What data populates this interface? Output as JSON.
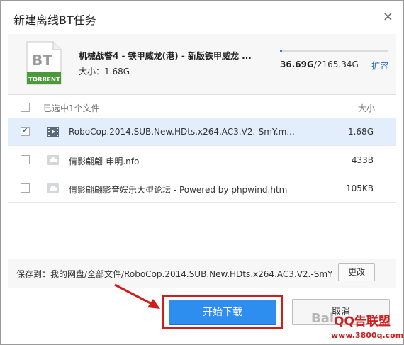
{
  "dialog": {
    "title": "新建离线BT任务",
    "close_glyph": "×"
  },
  "task": {
    "icon_text": "BT",
    "icon_label": "TORRENT",
    "name": "机械战警4 - 铁甲威龙(港) - 新版铁甲威龙 ...",
    "size_label": "大小：1.68G",
    "quota_used": "36.69G",
    "quota_total": "/2165.34G",
    "quota_fraction": 0.017,
    "expand_label": "扩容"
  },
  "list": {
    "header_label": "已选中1个文件",
    "header_size": "大小",
    "files": [
      {
        "name": "RoboCop.2014.SUB.New.HDts.x264.AC3.V2.-SmY.m...",
        "size": "1.68G",
        "checked": true,
        "icon": "video-file-icon"
      },
      {
        "name": "倩影翩翩-申明.nfo",
        "size": "433B",
        "checked": false,
        "icon": "cloud-file-icon"
      },
      {
        "name": "倩影翩翩影音娱乐大型论坛 - Powered by phpwind.htm",
        "size": "105KB",
        "checked": false,
        "icon": "cloud-file-icon"
      }
    ]
  },
  "save": {
    "label": "保存到：我的网盘/全部文件/RoboCop.2014.SUB.New.HDts.x264.AC3.V2.-SmY",
    "change_label": "更改"
  },
  "actions": {
    "start_label": "开始下载",
    "cancel_label": "取消"
  },
  "watermark": {
    "baidu": "Bai",
    "brand": "QQ告联盟",
    "url": "www.3800q.com"
  },
  "colors": {
    "accent": "#2e8ef0",
    "highlight_outline": "#d11c1c",
    "torrent_green": "#4a9a3a",
    "link": "#2a6fc9"
  }
}
